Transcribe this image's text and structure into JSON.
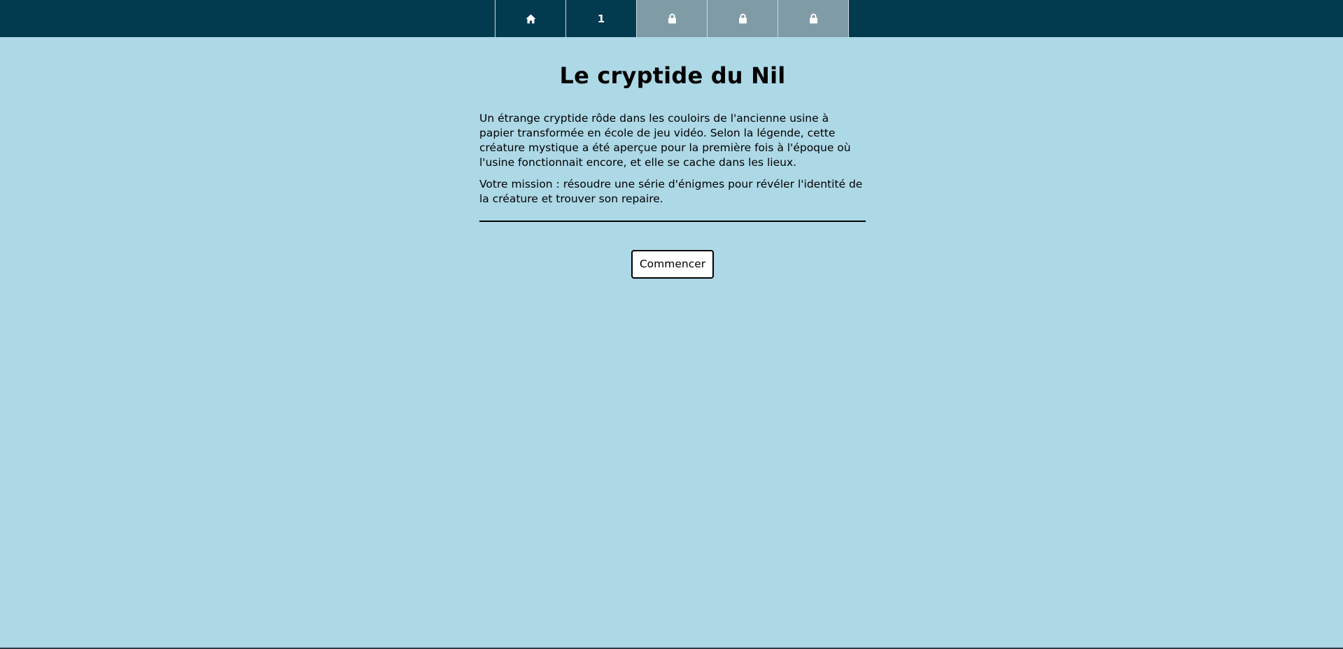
{
  "nav": {
    "items": [
      {
        "type": "home",
        "icon": "home-icon",
        "label": "",
        "state": "active"
      },
      {
        "type": "level",
        "icon": "",
        "label": "1",
        "state": "active"
      },
      {
        "type": "locked",
        "icon": "lock-icon",
        "label": "",
        "state": "locked"
      },
      {
        "type": "locked",
        "icon": "lock-icon",
        "label": "",
        "state": "locked"
      },
      {
        "type": "locked",
        "icon": "lock-icon",
        "label": "",
        "state": "locked"
      }
    ]
  },
  "main": {
    "title": "Le cryptide du Nil",
    "paragraphs": [
      "Un étrange cryptide rôde dans les couloirs de l'ancienne usine à papier transformée en école de jeu vidéo. Selon la légende, cette créature mystique a été aperçue pour la première fois à l'époque où l'usine fonctionnait encore, et elle se cache dans les lieux.",
      "Votre mission : résoudre une série d'énigmes pour révéler l'identité de la créature et trouver son repaire."
    ],
    "start_button": "Commencer"
  },
  "colors": {
    "background": "#add8e6",
    "topbar": "#023a4f",
    "locked_tab": "#7f9ba6"
  }
}
